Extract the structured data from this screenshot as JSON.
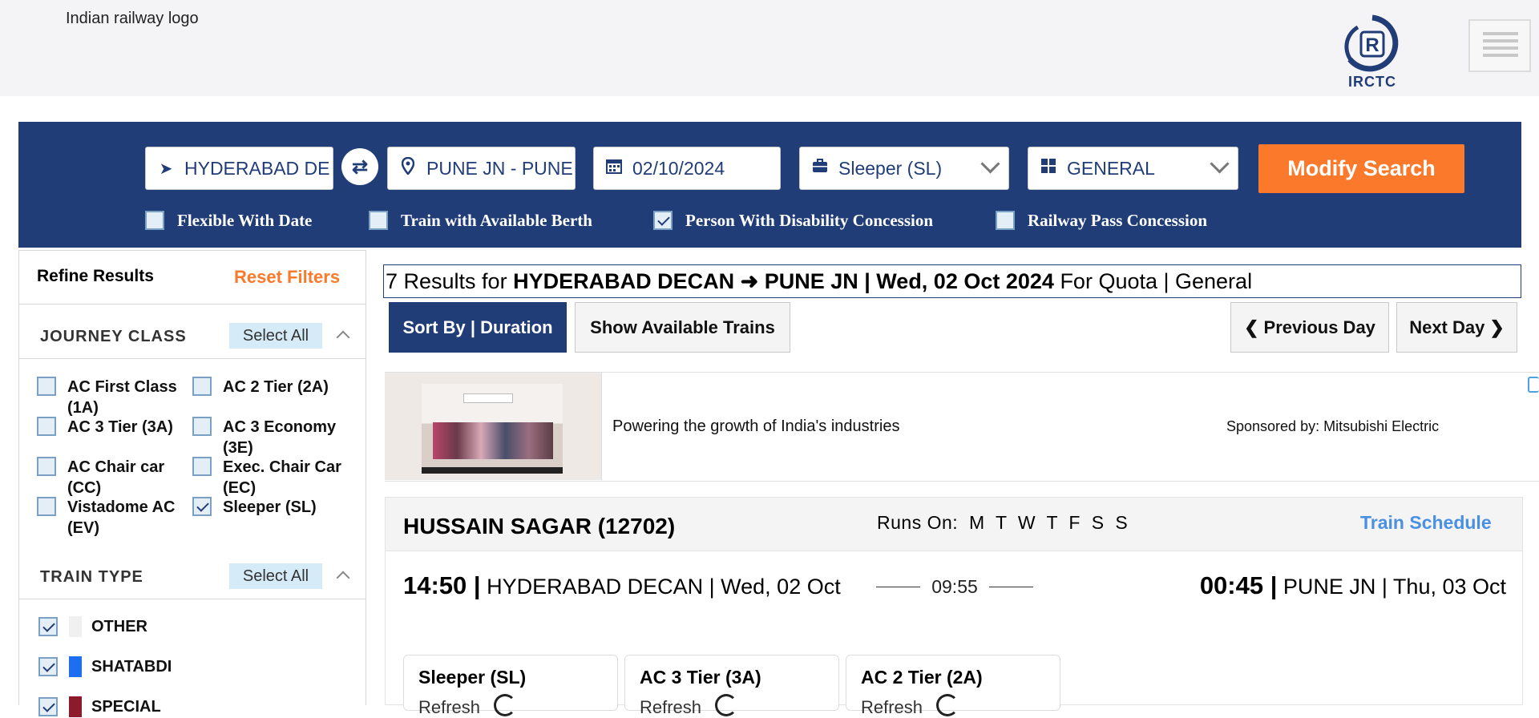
{
  "header": {
    "logo_alt": "Indian railway logo",
    "brand": "IRCTC"
  },
  "search": {
    "from": "HYDERABAD DE",
    "to": "PUNE JN - PUNE",
    "date": "02/10/2024",
    "class": "Sleeper (SL)",
    "quota": "GENERAL",
    "modify_label": "Modify Search",
    "options": [
      {
        "label": "Flexible With Date",
        "checked": false
      },
      {
        "label": "Train with Available Berth",
        "checked": false
      },
      {
        "label": "Person With Disability Concession",
        "checked": true
      },
      {
        "label": "Railway Pass Concession",
        "checked": false
      }
    ]
  },
  "sidebar": {
    "title": "Refine Results",
    "reset_label": "Reset Filters",
    "journey_class": {
      "title": "JOURNEY CLASS",
      "select_all": "Select All",
      "items": [
        {
          "label": "AC First Class (1A)",
          "checked": false
        },
        {
          "label": "AC 2 Tier (2A)",
          "checked": false
        },
        {
          "label": "AC 3 Tier (3A)",
          "checked": false
        },
        {
          "label": "AC 3 Economy (3E)",
          "checked": false
        },
        {
          "label": "AC Chair car (CC)",
          "checked": false
        },
        {
          "label": "Exec. Chair Car (EC)",
          "checked": false
        },
        {
          "label": "Vistadome AC (EV)",
          "checked": false
        },
        {
          "label": "Sleeper (SL)",
          "checked": true
        }
      ]
    },
    "train_type": {
      "title": "TRAIN TYPE",
      "select_all": "Select All",
      "items": [
        {
          "label": "OTHER",
          "checked": true,
          "color": "#f0f0f0"
        },
        {
          "label": "SHATABDI",
          "checked": true,
          "color": "#1e6ff0"
        },
        {
          "label": "SPECIAL",
          "checked": true,
          "color": "#8b1a2b"
        }
      ]
    }
  },
  "results": {
    "count_text": "7 Results for",
    "route": "HYDERABAD DECAN ➜ PUNE JN | Wed, 02 Oct 2024",
    "quota_text": "For Quota | General",
    "sort_label": "Sort By | Duration",
    "show_available_label": "Show Available Trains",
    "prev_day_label": "Previous Day",
    "next_day_label": "Next Day"
  },
  "ad": {
    "headline": "Powering the growth of India's industries",
    "sponsor": "Sponsored by: Mitsubishi Electric"
  },
  "train": {
    "name": "HUSSAIN SAGAR (12702)",
    "runs_on_label": "Runs On:",
    "runs_days": "M  T  W  T  F  S  S",
    "schedule_label": "Train Schedule",
    "dep_time": "14:50 |",
    "dep_info": " HYDERABAD DECAN | Wed, 02 Oct",
    "duration": "09:55",
    "arr_time": "00:45 |",
    "arr_info": " PUNE JN | Thu, 03 Oct",
    "classes": [
      {
        "name": "Sleeper (SL)",
        "refresh": "Refresh"
      },
      {
        "name": "AC 3 Tier (3A)",
        "refresh": "Refresh"
      },
      {
        "name": "AC 2 Tier (2A)",
        "refresh": "Refresh"
      }
    ]
  }
}
